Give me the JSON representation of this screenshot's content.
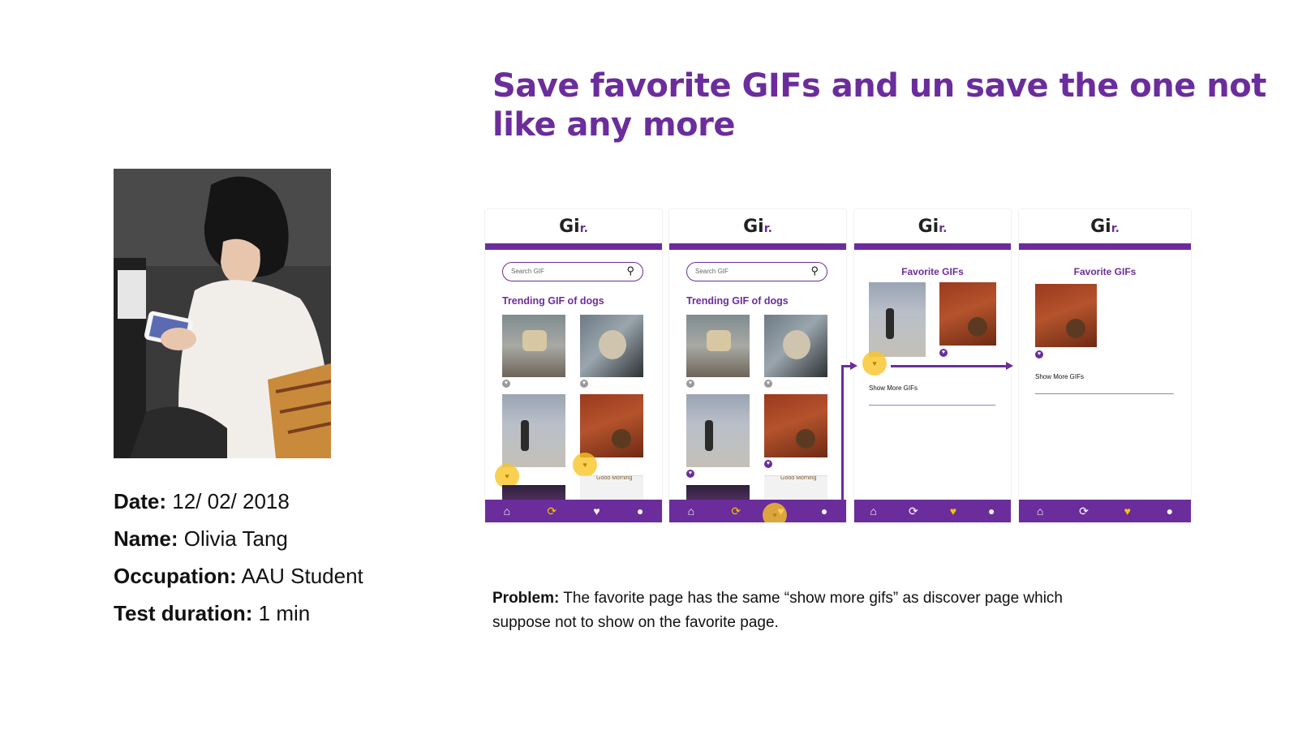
{
  "slide": {
    "title": "Save favorite GIFs and un save the one not like any more"
  },
  "tester": {
    "date_label": "Date:",
    "date_value": "12/ 02/ 2018",
    "name_label": "Name:",
    "name_value": "Olivia Tang",
    "occupation_label": "Occupation:",
    "occupation_value": "AAU Student",
    "duration_label": "Test duration:",
    "duration_value": "1 min"
  },
  "problem": {
    "label": "Problem:",
    "text": "The favorite page has the same “show more gifs” as discover page which suppose not to show on the favorite page."
  },
  "app": {
    "logo_main": "Gi",
    "logo_accent": "r.",
    "search_placeholder": "Search GIF",
    "trending_title": "Trending GIF of dogs",
    "favorites_title": "Favorite GIFs",
    "show_more": "Show More GIFs",
    "cartoon_caption": "Good Morning"
  },
  "icons": {
    "search": "search-icon",
    "home": "home-icon",
    "discover": "discover-icon",
    "favorite": "heart-icon",
    "profile": "user-icon"
  },
  "colors": {
    "brand_purple": "#6b2d9c",
    "highlight_yellow": "#f7c426"
  }
}
